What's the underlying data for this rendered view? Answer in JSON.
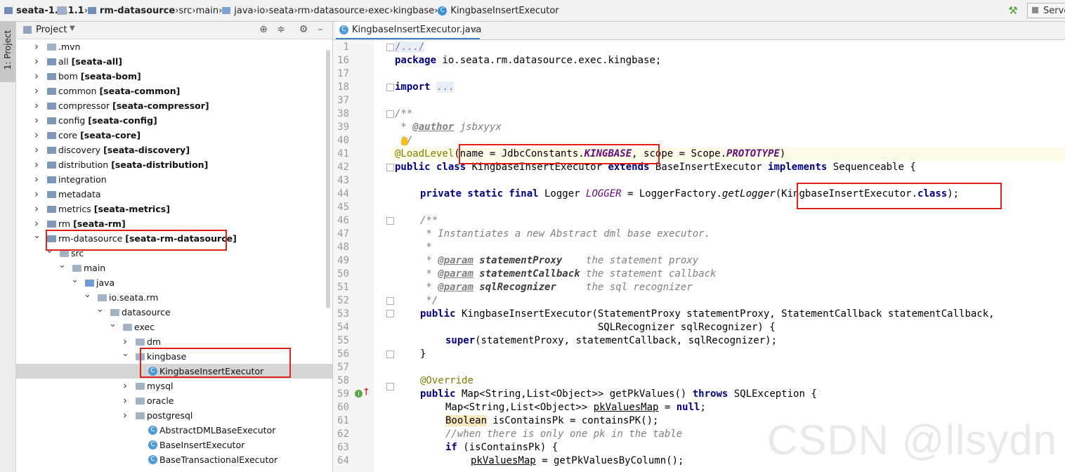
{
  "breadcrumb": [
    {
      "label": "seata-1.4.1.1",
      "icon": "module-icon",
      "bold": true
    },
    {
      "label": "rm-datasource",
      "icon": "module-icon",
      "bold": true
    },
    {
      "label": "src",
      "icon": "folder-icon"
    },
    {
      "label": "main",
      "icon": "folder-icon"
    },
    {
      "label": "java",
      "icon": "source-folder-icon"
    },
    {
      "label": "io",
      "icon": "folder-icon"
    },
    {
      "label": "seata",
      "icon": "folder-icon"
    },
    {
      "label": "rm",
      "icon": "folder-icon"
    },
    {
      "label": "datasource",
      "icon": "folder-icon"
    },
    {
      "label": "exec",
      "icon": "folder-icon"
    },
    {
      "label": "kingbase",
      "icon": "folder-icon"
    },
    {
      "label": "KingbaseInsertExecutor",
      "icon": "class-icon"
    }
  ],
  "toolbar": {
    "run_config_label": "Serve"
  },
  "tool_stripe": {
    "label": "1: Project"
  },
  "project_panel": {
    "title": "Project",
    "tree": [
      {
        "label": "",
        "name": ".mvn",
        "arrow": "right",
        "icon": "folder"
      },
      {
        "label": "[seata-all]",
        "name": "all",
        "arrow": "right",
        "icon": "module"
      },
      {
        "label": "[seata-bom]",
        "name": "bom",
        "arrow": "right",
        "icon": "module"
      },
      {
        "label": "[seata-common]",
        "name": "common",
        "arrow": "right",
        "icon": "module"
      },
      {
        "label": "[seata-compressor]",
        "name": "compressor",
        "arrow": "right",
        "icon": "module"
      },
      {
        "label": "[seata-config]",
        "name": "config",
        "arrow": "right",
        "icon": "module"
      },
      {
        "label": "[seata-core]",
        "name": "core",
        "arrow": "right",
        "icon": "module"
      },
      {
        "label": "[seata-discovery]",
        "name": "discovery",
        "arrow": "right",
        "icon": "module"
      },
      {
        "label": "[seata-distribution]",
        "name": "distribution",
        "arrow": "right",
        "icon": "module"
      },
      {
        "label": "",
        "name": "integration",
        "arrow": "right",
        "icon": "module"
      },
      {
        "label": "",
        "name": "metadata",
        "arrow": "right",
        "icon": "module"
      },
      {
        "label": "[seata-metrics]",
        "name": "metrics",
        "arrow": "right",
        "icon": "module"
      },
      {
        "label": "[seata-rm]",
        "name": "rm",
        "arrow": "right",
        "icon": "module"
      },
      {
        "label": "[seata-rm-datasource]",
        "name": "rm-datasource",
        "arrow": "down",
        "icon": "module"
      },
      {
        "label": "",
        "name": "src",
        "arrow": "down",
        "icon": "folder"
      },
      {
        "label": "",
        "name": "main",
        "arrow": "down",
        "icon": "folder"
      },
      {
        "label": "",
        "name": "java",
        "arrow": "down",
        "icon": "srcf"
      },
      {
        "label": "",
        "name": "io.seata.rm",
        "arrow": "down",
        "icon": "folder"
      },
      {
        "label": "",
        "name": "datasource",
        "arrow": "down",
        "icon": "folder"
      },
      {
        "label": "",
        "name": "exec",
        "arrow": "down",
        "icon": "folder"
      },
      {
        "label": "",
        "name": "dm",
        "arrow": "right",
        "icon": "folder"
      },
      {
        "label": "",
        "name": "kingbase",
        "arrow": "down",
        "icon": "folder"
      },
      {
        "label": "",
        "name": "KingbaseInsertExecutor",
        "arrow": "",
        "icon": "classi"
      },
      {
        "label": "",
        "name": "mysql",
        "arrow": "right",
        "icon": "folder"
      },
      {
        "label": "",
        "name": "oracle",
        "arrow": "right",
        "icon": "folder"
      },
      {
        "label": "",
        "name": "postgresql",
        "arrow": "right",
        "icon": "folder"
      },
      {
        "label": "",
        "name": "AbstractDMLBaseExecutor",
        "arrow": "",
        "icon": "classa"
      },
      {
        "label": "",
        "name": "BaseInsertExecutor",
        "arrow": "",
        "icon": "classa"
      },
      {
        "label": "",
        "name": "BaseTransactionalExecutor",
        "arrow": "",
        "icon": "classa"
      }
    ]
  },
  "editor": {
    "tab_label": "KingbaseInsertExecutor.java",
    "line_numbers": [
      "1",
      "16",
      "17",
      "18",
      "37",
      "38",
      "39",
      "40",
      "41",
      "42",
      "43",
      "44",
      "45",
      "46",
      "47",
      "48",
      "49",
      "50",
      "51",
      "52",
      "53",
      "54",
      "55",
      "56",
      "57",
      "58",
      "59",
      "60",
      "61",
      "62",
      "63",
      "64"
    ],
    "code": {
      "l1": "/.../",
      "l16_kw": "package",
      "l16_rest": " io.seata.rm.datasource.exec.kingbase;",
      "l18_kw": "import",
      "l18_rest": "...",
      "l38": "/**",
      "l39_pre": " * ",
      "l39_tag": "@author",
      "l39_rest": " jsbxyyx",
      "l40": " */",
      "l41_ann": "@LoadLevel",
      "l41_a": "(name = JdbcConstants.",
      "l41_b": "KINGBASE",
      "l41_c": ", scope = Scope.",
      "l41_d": "PROTOTYPE",
      "l41_e": ")",
      "l42_kw1": "public class",
      "l42_a": " KingbaseInsertExecutor ",
      "l42_kw2": "extends",
      "l42_b": " BaseInsertExecutor ",
      "l42_kw3": "implements",
      "l42_c": " Sequenceable {",
      "l44_kw": "private static final",
      "l44_a": " Logger ",
      "l44_b": "LOGGER",
      "l44_c": " = LoggerFactory.",
      "l44_d": "getLogger",
      "l44_e": "(KingbaseInsertExecutor.",
      "l44_f": "class",
      "l44_g": ");",
      "l46": "/**",
      "l47": " * Instantiates a new Abstract dml base executor.",
      "l48": " *",
      "l49_pre": " * ",
      "l49_tag": "@param",
      "l49_p": " statementProxy",
      "l49_rest": "    the statement proxy",
      "l50_pre": " * ",
      "l50_tag": "@param",
      "l50_p": " statementCallback",
      "l50_rest": " the statement callback",
      "l51_pre": " * ",
      "l51_tag": "@param",
      "l51_p": " sqlRecognizer",
      "l51_rest": "     the sql recognizer",
      "l52": " */",
      "l53_kw": "public",
      "l53_rest": " KingbaseInsertExecutor(StatementProxy statementProxy, StatementCallback statementCallback,",
      "l54": "                              SQLRecognizer sqlRecognizer) {",
      "l55_kw": "super",
      "l55_rest": "(statementProxy, statementCallback, sqlRecognizer);",
      "l56": "}",
      "l58": "@Override",
      "l59_kw": "public",
      "l59_a": " Map<String,List<Object>> getPkValues() ",
      "l59_kw2": "throws",
      "l59_b": " SQLException {",
      "l60_a": "Map<String,List<Object>> ",
      "l60_b": "pkValuesMap",
      "l60_c": " = ",
      "l60_kw": "null",
      "l60_d": ";",
      "l61_a": "Boolean",
      "l61_b": " isContainsPk = containsPK();",
      "l62": "//when there is only one pk in the table",
      "l63_kw": "if",
      "l63_rest": " (isContainsPk) {",
      "l64_a": "pkValuesMap",
      "l64_b": " = getPkValuesByColumn();"
    }
  },
  "watermark": "CSDN @llsydn"
}
